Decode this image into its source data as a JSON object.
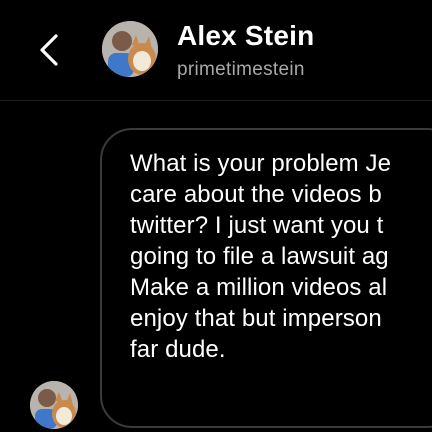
{
  "header": {
    "back_icon": "chevron-left-icon",
    "name": "Alex Stein",
    "username": "primetimestein"
  },
  "message": {
    "text": "What is your problem Je\ncare about the videos b\ntwitter? I just want you t\ngoing to file a lawsuit ag\nMake a million videos al\nenjoy that but imperson\nfar dude."
  },
  "colors": {
    "background": "#000000",
    "primary_text": "#ffffff",
    "secondary_text": "#a8a8a8",
    "bubble_border": "#3a3a3a"
  }
}
